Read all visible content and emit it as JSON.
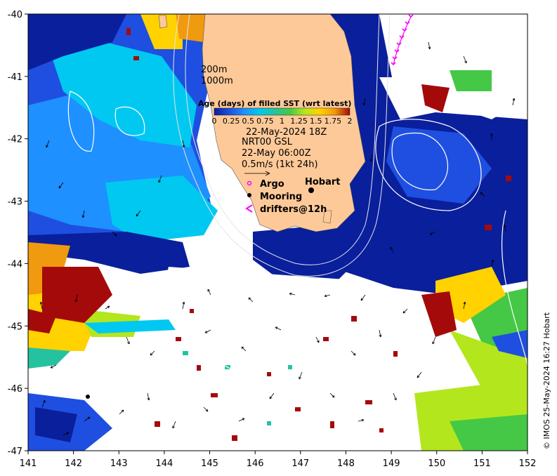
{
  "axes": {
    "lon_ticks": [
      "141",
      "142",
      "143",
      "144",
      "145",
      "146",
      "147",
      "148",
      "149",
      "150",
      "151",
      "152"
    ],
    "lat_ticks": [
      "-40",
      "-41",
      "-42",
      "-43",
      "-44",
      "-45",
      "-46",
      "-47"
    ],
    "lon_range": [
      141,
      152
    ],
    "lat_range": [
      -47,
      -40
    ]
  },
  "isobaths": [
    "200m",
    "1000m"
  ],
  "colorbar": {
    "title": "Age (days) of filled SST (wrt latest)",
    "tick_labels": [
      "0",
      "0.25",
      "0.5",
      "0.75",
      "1",
      "1.25",
      "1.5",
      "1.75",
      "2"
    ],
    "range": [
      0,
      2
    ],
    "colors": [
      "#0a1f9c",
      "#1f4fe0",
      "#1e90ff",
      "#00c8f0",
      "#25c2a0",
      "#45c845",
      "#b4e61e",
      "#ffd200",
      "#f09a10",
      "#a50a0a"
    ]
  },
  "info": {
    "sst_time": "22-May-2024 18Z",
    "currents_product": "NRT00 GSL",
    "currents_time": "22-May 06:00Z",
    "scale_label": "0.5m/s (1kt 24h)"
  },
  "legend": {
    "argo": "Argo",
    "mooring": "Mooring",
    "drifters": "drifters@12h"
  },
  "places": {
    "hobart": "Hobart"
  },
  "credit": "© IMOS 25-May-2024 16:27 Hobart",
  "colors": {
    "land": "#fec998",
    "no_data": "#ffffff",
    "argo_marker": "#ff00ff",
    "mooring_marker": "#000000",
    "drifter_track": "#ff00ff"
  }
}
